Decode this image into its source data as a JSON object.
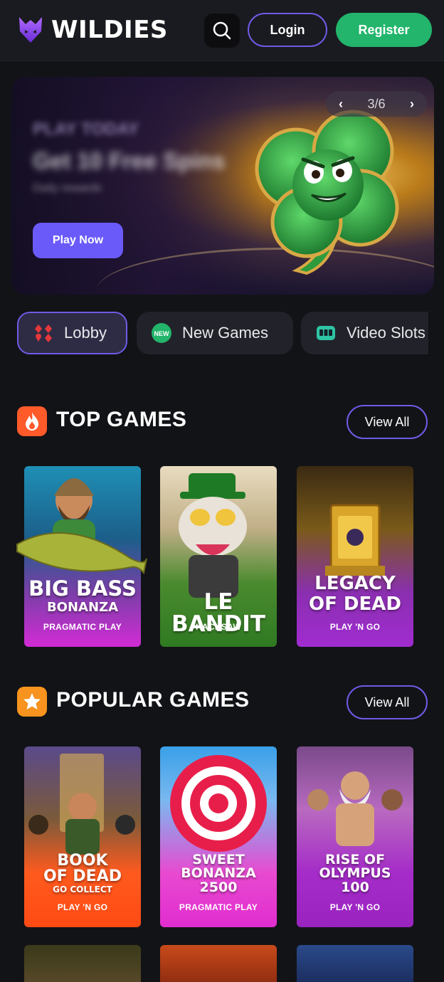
{
  "header": {
    "brand": "WILDIES",
    "login_label": "Login",
    "register_label": "Register",
    "icons": {
      "logo": "wolf-logo-icon",
      "search": "search-icon"
    }
  },
  "banner": {
    "eyebrow": "PLAY TODAY",
    "title": "Get 10 Free Spins",
    "subtitle": "Daily rewards",
    "cta_label": "Play Now",
    "slide_indicator": "3/6",
    "prev_icon": "chevron-left-icon",
    "next_icon": "chevron-right-icon"
  },
  "categories": [
    {
      "label": "Lobby",
      "icon": "cards-icon",
      "active": true
    },
    {
      "label": "New Games",
      "icon": "new-badge-icon",
      "active": false
    },
    {
      "label": "Video Slots",
      "icon": "slot-machine-icon",
      "active": false
    }
  ],
  "top_games": {
    "title": "TOP GAMES",
    "icon": "fire-icon",
    "view_all_label": "View All",
    "games": [
      {
        "title_line1": "BIG BASS",
        "title_line2": "BONANZA",
        "provider": "PRAGMATIC PLAY"
      },
      {
        "title_line1": "LE BANDIT",
        "title_line2": "",
        "provider": "HACKSAW"
      },
      {
        "title_line1": "LEGACY",
        "title_line2": "OF DEAD",
        "provider": "PLAY 'N GO"
      }
    ]
  },
  "popular_games": {
    "title": "POPULAR GAMES",
    "icon": "star-icon",
    "view_all_label": "View All",
    "games": [
      {
        "title_line1": "BOOK",
        "title_line2": "OF DEAD",
        "title_line3": "GO COLLECT",
        "provider": "PLAY 'N GO"
      },
      {
        "title_line1": "SWEET",
        "title_line2": "BONANZA",
        "title_line3": "2500",
        "provider": "PRAGMATIC PLAY"
      },
      {
        "title_line1": "RISE OF",
        "title_line2": "OLYMPUS",
        "title_line3": "100",
        "provider": "PLAY 'N GO"
      }
    ]
  },
  "colors": {
    "background": "#121317",
    "accent": "#6c5ce7",
    "register_green": "#22b56b",
    "cta_purple": "#6a5af9"
  }
}
